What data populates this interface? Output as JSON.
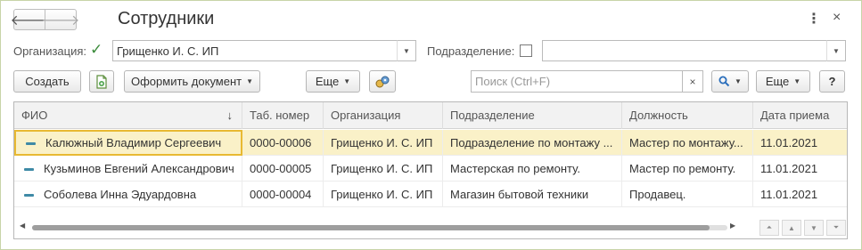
{
  "window": {
    "title": "Сотрудники",
    "back_icon": "arrow-left-icon",
    "forward_icon": "arrow-right-icon",
    "more_glyph": "⋮",
    "close_glyph": "×"
  },
  "filters": {
    "organization_label": "Организация:",
    "organization_checked": true,
    "organization_value": "Грищенко И. С. ИП",
    "department_label": "Подразделение:",
    "department_checked": false,
    "department_value": ""
  },
  "toolbar": {
    "create_label": "Создать",
    "issue_document_label": "Оформить документ",
    "more_label": "Еще",
    "search_placeholder": "Поиск (Ctrl+F)",
    "search_clear_glyph": "×",
    "more2_label": "Еще",
    "help_label": "?"
  },
  "table": {
    "columns": [
      "ФИО",
      "Таб. номер",
      "Организация",
      "Подразделение",
      "Должность",
      "Дата приема"
    ],
    "rows": [
      {
        "fio": "Калюжный Владимир Сергеевич",
        "tab_number": "0000-00006",
        "organization": "Грищенко И. С. ИП",
        "department": "Подразделение по монтажу ...",
        "position": "Мастер по монтажу...",
        "hire_date": "11.01.2021",
        "selected": true
      },
      {
        "fio": "Кузьминов Евгений Александрович",
        "tab_number": "0000-00005",
        "organization": "Грищенко И. С. ИП",
        "department": "Мастерская по ремонту.",
        "position": "Мастер по ремонту.",
        "hire_date": "11.01.2021",
        "selected": false
      },
      {
        "fio": "Соболева Инна Эдуардовна",
        "tab_number": "0000-00004",
        "organization": "Грищенко И. С. ИП",
        "department": "Магазин бытовой техники",
        "position": "Продавец.",
        "hire_date": "11.01.2021",
        "selected": false
      }
    ]
  },
  "colors": {
    "selected_row": "#faf1c8",
    "focus_border": "#e8b932",
    "check_green": "#3b8b3b",
    "row_icon": "#3f8aa6"
  }
}
